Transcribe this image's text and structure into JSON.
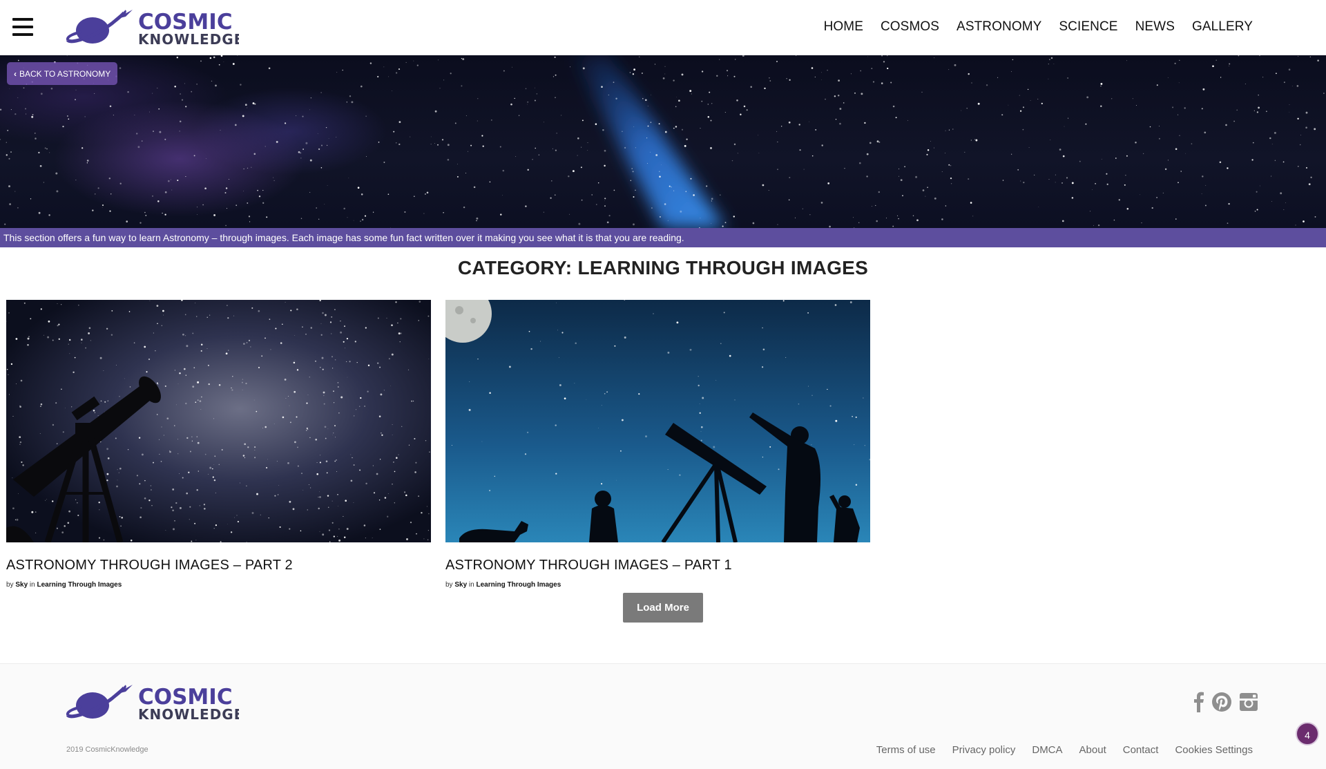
{
  "header": {
    "logo": {
      "line1": "COSMIC",
      "line2": "KNOWLEDGE"
    },
    "nav": [
      "HOME",
      "COSMOS",
      "ASTRONOMY",
      "SCIENCE",
      "NEWS",
      "GALLERY"
    ]
  },
  "hero": {
    "back_label": "BACK TO ASTRONOMY",
    "description": "This section offers a fun way to learn Astronomy – through images. Each image has some fun fact written over it making you see what it is that you are reading."
  },
  "category_title": "CATEGORY: LEARNING THROUGH IMAGES",
  "posts": [
    {
      "title": "ASTRONOMY THROUGH IMAGES – PART 2",
      "by": "by",
      "author": "Sky",
      "in": "in",
      "category": "Learning Through Images"
    },
    {
      "title": "ASTRONOMY THROUGH IMAGES – PART 1",
      "by": "by",
      "author": "Sky",
      "in": "in",
      "category": "Learning Through Images"
    }
  ],
  "load_more_label": "Load More",
  "footer": {
    "logo": {
      "line1": "COSMIC",
      "line2": "KNOWLEDGE"
    },
    "copyright": "2019 CosmicKnowledge",
    "social_icons": [
      "facebook-icon",
      "pinterest-icon",
      "instagram-icon"
    ],
    "links": [
      "Terms of use",
      "Privacy policy",
      "DMCA",
      "About",
      "Contact",
      "Cookies Settings"
    ]
  },
  "chat_badge_count": "4",
  "colors": {
    "brand_purple": "#4b3f9b",
    "desc_bar": "#5d4e9e",
    "button_gray": "#7a7a7a",
    "badge": "#6b2c6e"
  }
}
